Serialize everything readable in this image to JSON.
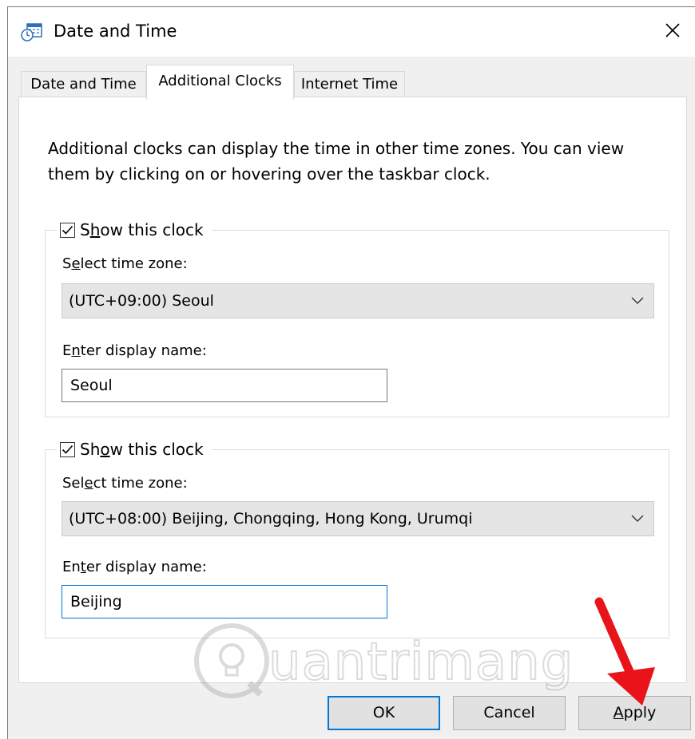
{
  "window": {
    "title": "Date and Time"
  },
  "tabs": [
    {
      "label": "Date and Time"
    },
    {
      "label": "Additional Clocks"
    },
    {
      "label": "Internet Time"
    }
  ],
  "description": "Additional clocks can display the time in other time zones. You can view them by clicking on or hovering over the taskbar clock.",
  "clock1": {
    "show_label_pre": "S",
    "show_label_ul": "h",
    "show_label_post": "ow this clock",
    "checked": true,
    "tz_label_pre": "S",
    "tz_label_ul": "e",
    "tz_label_post": "lect time zone:",
    "timezone": "(UTC+09:00) Seoul",
    "name_label_pre": "E",
    "name_label_ul": "n",
    "name_label_post": "ter display name:",
    "display_name": "Seoul"
  },
  "clock2": {
    "show_label_pre": "Sh",
    "show_label_ul": "o",
    "show_label_post": "w this clock",
    "checked": true,
    "tz_label_pre": "Sel",
    "tz_label_ul": "e",
    "tz_label_post": "ct time zone:",
    "timezone": "(UTC+08:00) Beijing, Chongqing, Hong Kong, Urumqi",
    "name_label_pre": "En",
    "name_label_ul": "t",
    "name_label_post": "er display name:",
    "display_name": "Beijing"
  },
  "buttons": {
    "ok": "OK",
    "cancel": "Cancel",
    "apply_ul": "A",
    "apply_post": "pply"
  },
  "watermark": {
    "text": "uantrimang"
  },
  "colors": {
    "accent": "#0078d7",
    "arrow": "#e8141a"
  }
}
